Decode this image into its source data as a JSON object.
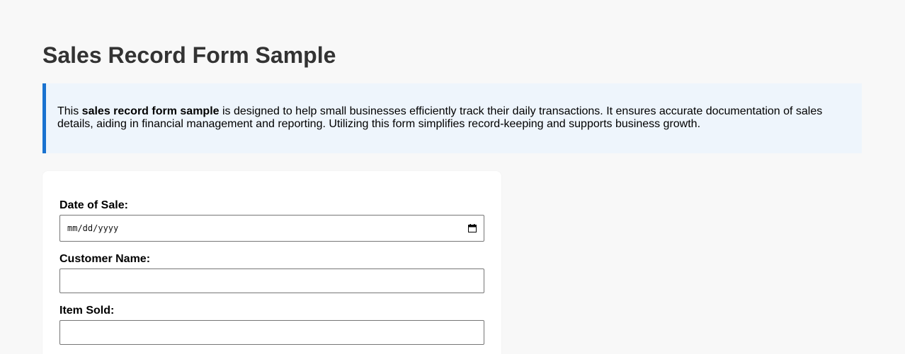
{
  "page": {
    "title": "Sales Record Form Sample"
  },
  "intro": {
    "prefix": "This ",
    "bold": "sales record form sample",
    "suffix": " is designed to help small businesses efficiently track their daily transactions. It ensures accurate documentation of sales details, aiding in financial management and reporting. Utilizing this form simplifies record-keeping and supports business growth."
  },
  "form": {
    "date_label": "Date of Sale:",
    "date_placeholder": "mm/dd/yyyy",
    "customer_label": "Customer Name:",
    "customer_value": "",
    "item_label": "Item Sold:",
    "item_value": ""
  },
  "colors": {
    "accent": "#1a73d0",
    "intro_bg": "#eef5fc",
    "title": "#333333",
    "page_bg": "#f8f8f8"
  },
  "icons": {
    "date_picker": "calendar-icon"
  }
}
